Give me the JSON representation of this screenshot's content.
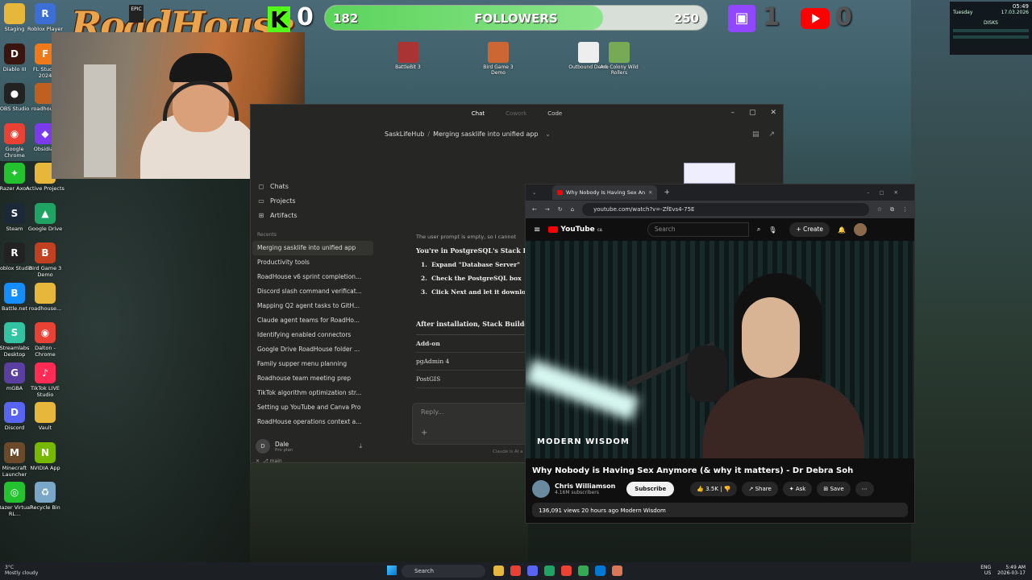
{
  "overlay": {
    "logo_text": "RoadHouse",
    "kick_count": "0",
    "followers": {
      "current": "182",
      "label": "FOLLOWERS",
      "goal": "250",
      "fraction": 0.728
    },
    "twitch_count": "1",
    "youtube_count": "0"
  },
  "desktop_icons": [
    {
      "label": "Staging",
      "color": "#e6b73b",
      "glyph": ""
    },
    {
      "label": "Roblox Player",
      "color": "#3b6fd6",
      "glyph": "R"
    },
    {
      "label": "Diablo III",
      "color": "#3a1510",
      "glyph": "D"
    },
    {
      "label": "FL Studio 2024",
      "color": "#f07a1a",
      "glyph": "F"
    },
    {
      "label": "OBS Studio",
      "color": "#222",
      "glyph": "●"
    },
    {
      "label": "roadhouse",
      "color": "#c06020",
      "glyph": ""
    },
    {
      "label": "Google Chrome",
      "color": "#e94235",
      "glyph": "◉"
    },
    {
      "label": "Obsidian",
      "color": "#7c3aed",
      "glyph": "◆"
    },
    {
      "label": "Razer Axon",
      "color": "#22c32e",
      "glyph": "✦"
    },
    {
      "label": "Active Projects",
      "color": "#e6b73b",
      "glyph": ""
    },
    {
      "label": "Steam",
      "color": "#1b2838",
      "glyph": "S"
    },
    {
      "label": "Google Drive",
      "color": "#1fa463",
      "glyph": "▲"
    },
    {
      "label": "Roblox Studio",
      "color": "#222",
      "glyph": "R"
    },
    {
      "label": "Bird Game 3 Demo",
      "color": "#c04020",
      "glyph": "B"
    },
    {
      "label": "Battle.net",
      "color": "#148eff",
      "glyph": "B"
    },
    {
      "label": "roadhouse...",
      "color": "#e6b73b",
      "glyph": ""
    },
    {
      "label": "Streamlabs Desktop",
      "color": "#31c3a2",
      "glyph": "S"
    },
    {
      "label": "Dalton - Chrome",
      "color": "#e94235",
      "glyph": "◉"
    },
    {
      "label": "mGBA",
      "color": "#5a3fa0",
      "glyph": "G"
    },
    {
      "label": "TikTok LIVE Studio",
      "color": "#fe2c55",
      "glyph": "♪"
    },
    {
      "label": "Discord",
      "color": "#5865f2",
      "glyph": "D"
    },
    {
      "label": "Vault",
      "color": "#e6b73b",
      "glyph": ""
    },
    {
      "label": "Minecraft Launcher",
      "color": "#6a4a2a",
      "glyph": "M"
    },
    {
      "label": "NVIDIA App",
      "color": "#76b900",
      "glyph": "N"
    },
    {
      "label": "Razer Virtual RL...",
      "color": "#22c32e",
      "glyph": "◎"
    },
    {
      "label": "Recycle Bin",
      "color": "#7aa7c7",
      "glyph": "♻"
    }
  ],
  "top_apps": [
    {
      "label": "BattleBit 3",
      "color": "#a33"
    },
    {
      "label": "Bird Game 3 Demo",
      "color": "#c63"
    },
    {
      "label": "Outbound Demo",
      "color": "#eee"
    },
    {
      "label": "Ark Colony Wild Rollers",
      "color": "#7a5"
    }
  ],
  "perf_widget": {
    "time": "05:49",
    "day": "Tuesday",
    "date": "17.03.2026",
    "disks": "DISKS"
  },
  "claude": {
    "tabs": [
      "Chat",
      "Cowork",
      "Code"
    ],
    "breadcrumb_project": "SaskLifeHub",
    "breadcrumb_chat": "Merging sasklife into unified app",
    "nav": [
      {
        "label": "Chats",
        "icon": "chat-icon",
        "glyph": "◻"
      },
      {
        "label": "Projects",
        "icon": "folder-icon",
        "glyph": "▭"
      },
      {
        "label": "Artifacts",
        "icon": "artifacts-icon",
        "glyph": "⊞"
      }
    ],
    "recents_label": "Recents",
    "recents": [
      "Merging sasklife into unified app",
      "Productivity tools",
      "RoadHouse v6 sprint completion...",
      "Discord slash command verificat...",
      "Mapping Q2 agent tasks to GitH...",
      "Claude agent teams for RoadHo...",
      "Identifying enabled connectors",
      "Google Drive RoadHouse folder ...",
      "Family supper menu planning",
      "Roadhouse team meeting prep",
      "TikTok algorithm optimization str...",
      "Setting up YouTube and Canva Pro",
      "RoadHouse operations context a..."
    ],
    "user": {
      "initial": "D",
      "name": "Dale",
      "plan": "Pro plan"
    },
    "status_bar": "main",
    "message": {
      "intro": "The user prompt is empty, so I cannot",
      "line1": "You're in PostgreSQL's Stack Bu",
      "steps": [
        "Expand \"Database Server\"",
        "Check the PostgreSQL box",
        "Click Next and let it downlo"
      ],
      "after": "After installation, Stack Builde",
      "table_header": "Add-on",
      "table_rows": [
        "pgAdmin 4",
        "PostGIS"
      ]
    },
    "reply_placeholder": "Reply...",
    "disclaimer": "Claude is AI a"
  },
  "youtube": {
    "tab_title": "Why Nobody Is Having Sex Anymore",
    "url": "youtube.com/watch?v=-ZfEvs4-75E",
    "brand": "YouTube",
    "brand_suffix": "CA",
    "search_placeholder": "Search",
    "create_label": "Create",
    "video_watermark": "MODERN WISDOM",
    "video_title": "Why Nobody is Having Sex Anymore (& why it matters) - Dr Debra Soh",
    "channel_name": "Chris Williamson",
    "subscribers": "4.16M subscribers",
    "subscribe_label": "Subscribe",
    "likes": "3.5K",
    "share_label": "Share",
    "ask_label": "Ask",
    "save_label": "Save",
    "meta": "136,091 views  20 hours ago  Modern Wisdom"
  },
  "taskbar": {
    "weather_temp": "3°C",
    "weather_desc": "Mostly cloudy",
    "search_label": "Search",
    "lang": "ENG",
    "region": "US",
    "time": "5:49 AM",
    "date": "2026-03-17"
  }
}
